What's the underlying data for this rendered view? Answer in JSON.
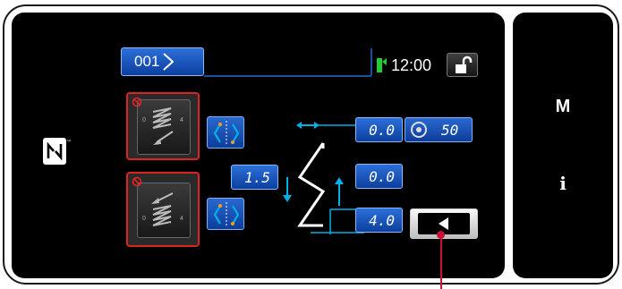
{
  "header": {
    "program_number": "001",
    "time": "12:00",
    "status_color": "#22cc33"
  },
  "left_panel": {
    "nfc_icon": "nfc-icon"
  },
  "zigzag": {
    "width_value": "0.0",
    "speed_value": "50",
    "reverse_pitch_value": "1.5",
    "forward_pitch_value": "0.0",
    "length_value": "4.0"
  },
  "sidebar": {
    "menu_label": "M",
    "info_label": "i"
  },
  "colors": {
    "accent": "#00b0e6",
    "button_blue": "#1a56c0",
    "warning_red": "#dd2222"
  }
}
